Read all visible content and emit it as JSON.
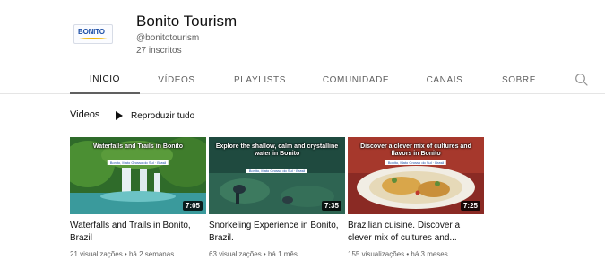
{
  "channel": {
    "name": "Bonito Tourism",
    "handle": "@bonitotourism",
    "subscribers": "27 inscritos",
    "logo_text": "BONITO"
  },
  "tabs": [
    {
      "label": "INÍCIO",
      "active": true
    },
    {
      "label": "VÍDEOS",
      "active": false
    },
    {
      "label": "PLAYLISTS",
      "active": false
    },
    {
      "label": "COMUNIDADE",
      "active": false
    },
    {
      "label": "CANAIS",
      "active": false
    },
    {
      "label": "SOBRE",
      "active": false
    }
  ],
  "search_icon": "search-icon",
  "section": {
    "title": "Videos",
    "play_all_label": "Reproduzir tudo"
  },
  "videos": [
    {
      "thumb_title": "Waterfalls and Trails in Bonito",
      "thumb_sub": "Bonito, Mato Grosso do Sul · Brasil",
      "duration": "7:05",
      "title": "Waterfalls and Trails in Bonito, Brazil",
      "meta": "21 visualizações • há 2 semanas"
    },
    {
      "thumb_title": "Explore the shallow, calm and crystalline water in Bonito",
      "thumb_sub": "Bonito, Mato Grosso do Sul · Brasil",
      "duration": "7:35",
      "title": "Snorkeling Experience in Bonito, Brazil.",
      "meta": "63 visualizações • há 1 mês"
    },
    {
      "thumb_title": "Discover a clever mix of cultures and flavors in Bonito",
      "thumb_sub": "Bonito, Mato Grosso do Sul · Brasil",
      "duration": "7:25",
      "title": "Brazilian cuisine. Discover a clever mix of cultures and...",
      "meta": "155 visualizações • há 3 meses"
    }
  ],
  "colors": {
    "text_primary": "#0f0f0f",
    "text_secondary": "#606060",
    "divider": "#e5e5e5",
    "logo_blue": "#1d4fa6",
    "logo_yellow": "#f2b705"
  }
}
